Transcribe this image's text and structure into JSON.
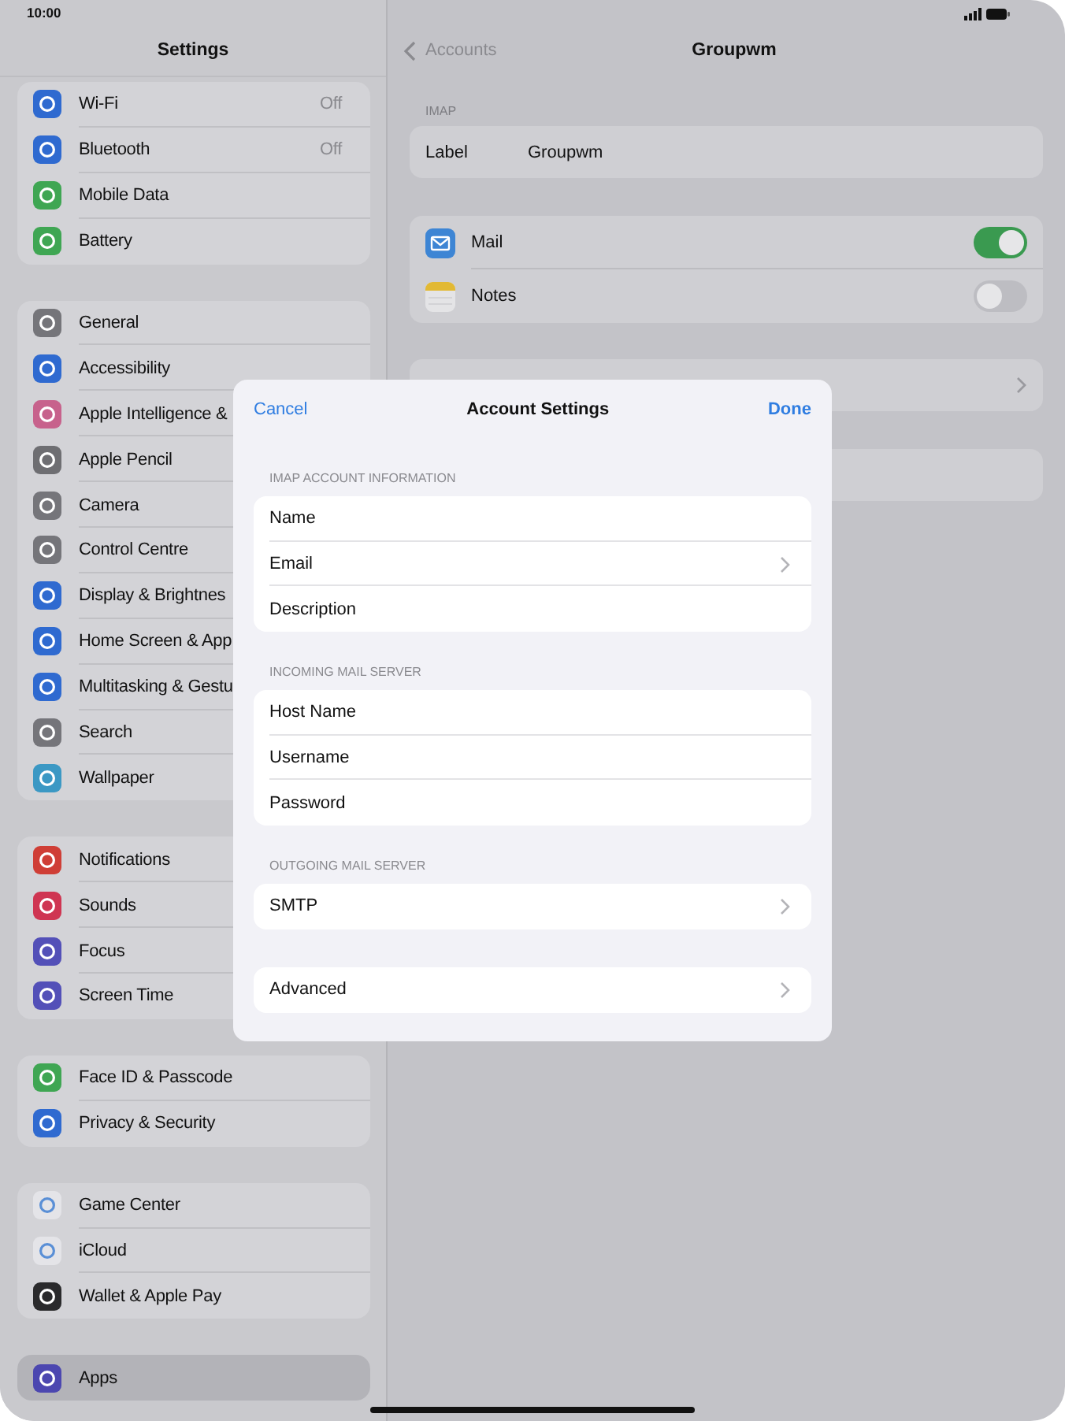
{
  "status_bar": {
    "time": "10:00"
  },
  "sidebar": {
    "title": "Settings",
    "groups": [
      {
        "items": [
          {
            "label": "Wi-Fi",
            "value": "Off",
            "color": "#2f6ad0",
            "selected": false
          },
          {
            "label": "Bluetooth",
            "value": "Off",
            "color": "#2f6ad0",
            "selected": false
          },
          {
            "label": "Mobile Data",
            "color": "#3fa653",
            "selected": false
          },
          {
            "label": "Battery",
            "color": "#3fa653",
            "selected": false
          }
        ]
      },
      {
        "items": [
          {
            "label": "General",
            "color": "#75757a",
            "selected": false
          },
          {
            "label": "Accessibility",
            "color": "#2f6ad0",
            "selected": false
          },
          {
            "label": "Apple Intelligence &",
            "color": "#c7628c",
            "selected": false
          },
          {
            "label": "Apple Pencil",
            "color": "#6e6e72",
            "selected": false
          },
          {
            "label": "Camera",
            "color": "#75757a",
            "selected": false
          },
          {
            "label": "Control Centre",
            "color": "#75757a",
            "selected": false
          },
          {
            "label": "Display & Brightnes",
            "color": "#2f6ad0",
            "selected": false
          },
          {
            "label": "Home Screen & App",
            "color": "#2f6ad0",
            "selected": false
          },
          {
            "label": "Multitasking & Gestu",
            "color": "#2f6ad0",
            "selected": false
          },
          {
            "label": "Search",
            "color": "#75757a",
            "selected": false
          },
          {
            "label": "Wallpaper",
            "color": "#3b98c4",
            "selected": false
          }
        ]
      },
      {
        "items": [
          {
            "label": "Notifications",
            "color": "#cf3e36",
            "selected": false
          },
          {
            "label": "Sounds",
            "color": "#cf3552",
            "selected": false
          },
          {
            "label": "Focus",
            "color": "#5350b8",
            "selected": false
          },
          {
            "label": "Screen Time",
            "color": "#5350b8",
            "selected": false
          }
        ]
      },
      {
        "items": [
          {
            "label": "Face ID & Passcode",
            "color": "#3fa653",
            "selected": false
          },
          {
            "label": "Privacy & Security",
            "color": "#2f6ad0",
            "selected": false
          }
        ]
      },
      {
        "items": [
          {
            "label": "Game Center",
            "color": "#e4e4e8",
            "selected": false
          },
          {
            "label": "iCloud",
            "color": "#e4e4e8",
            "selected": false
          },
          {
            "label": "Wallet & Apple Pay",
            "color": "#2a2a2c",
            "selected": false
          }
        ]
      },
      {
        "items": [
          {
            "label": "Apps",
            "color": "#4c47b0",
            "selected": true
          }
        ]
      }
    ]
  },
  "detail": {
    "back": "Accounts",
    "title": "Groupwm",
    "section": "IMAP",
    "label_row": {
      "label": "Label",
      "value": "Groupwm"
    },
    "toggles": [
      {
        "label": "Mail",
        "on": true
      },
      {
        "label": "Notes",
        "on": false
      }
    ]
  },
  "sheet": {
    "cancel": "Cancel",
    "title": "Account Settings",
    "done": "Done",
    "sections": [
      {
        "title": "IMAP ACCOUNT INFORMATION",
        "rows": [
          {
            "label": "Name",
            "disclosure": false
          },
          {
            "label": "Email",
            "disclosure": true
          },
          {
            "label": "Description",
            "disclosure": false
          }
        ]
      },
      {
        "title": "INCOMING MAIL SERVER",
        "rows": [
          {
            "label": "Host Name",
            "disclosure": false
          },
          {
            "label": "Username",
            "disclosure": false
          },
          {
            "label": "Password",
            "disclosure": false
          }
        ]
      },
      {
        "title": "OUTGOING MAIL SERVER",
        "rows": [
          {
            "label": "SMTP",
            "disclosure": true
          }
        ]
      },
      {
        "rows": [
          {
            "label": "Advanced",
            "disclosure": true
          }
        ]
      }
    ]
  }
}
